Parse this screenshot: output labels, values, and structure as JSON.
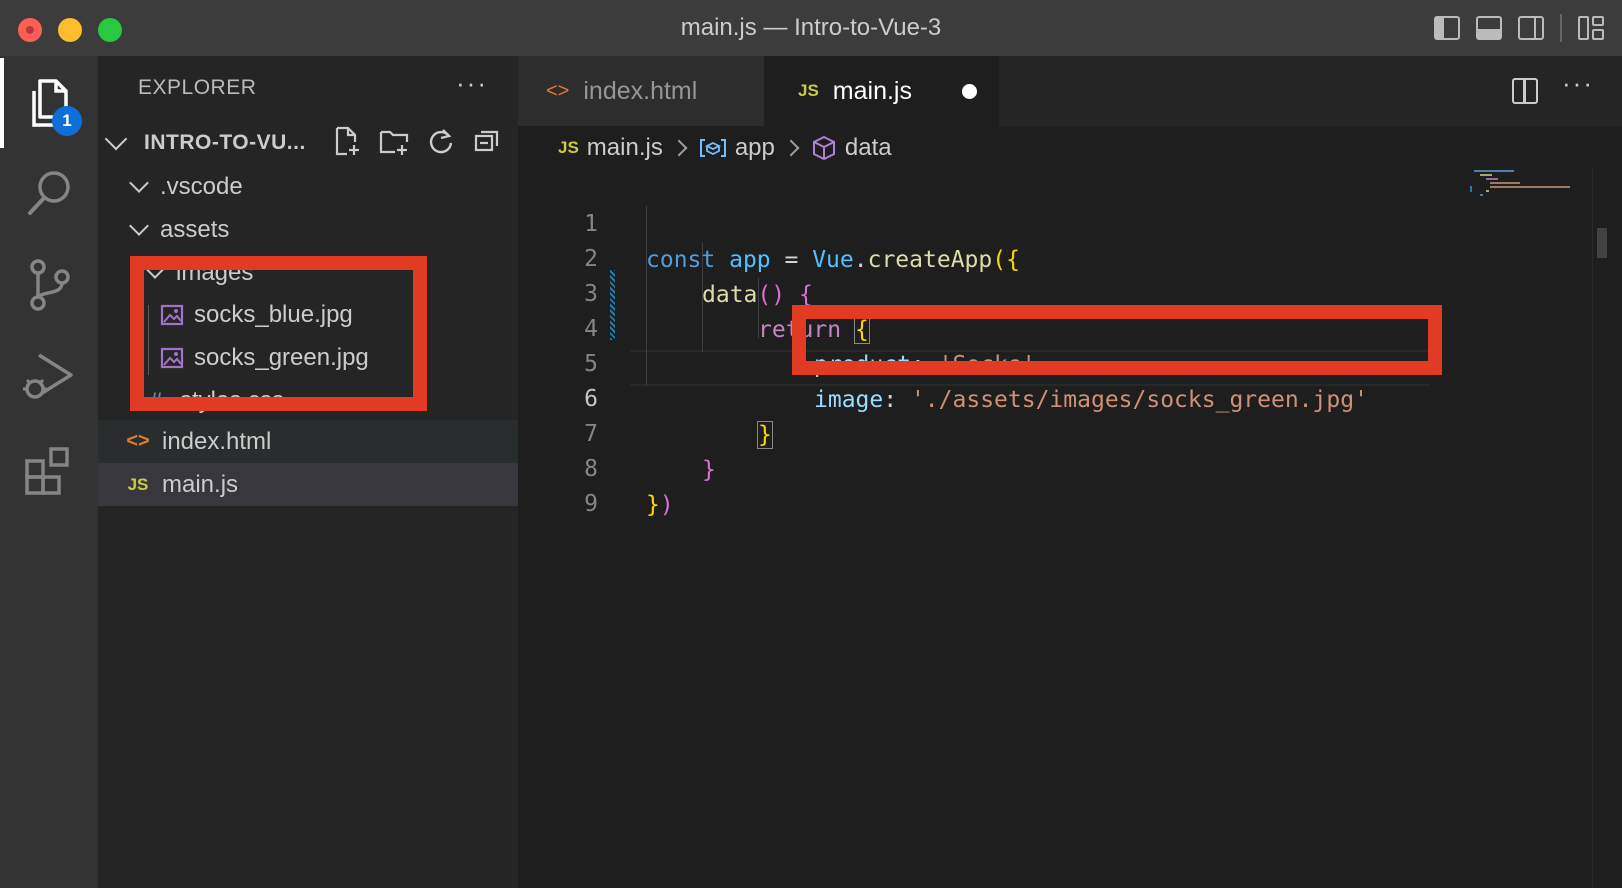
{
  "window": {
    "title": "main.js — Intro-to-Vue-3"
  },
  "activity_bar": {
    "items": [
      {
        "name": "explorer",
        "badge": "1"
      },
      {
        "name": "search"
      },
      {
        "name": "source-control"
      },
      {
        "name": "run-and-debug"
      },
      {
        "name": "extensions"
      }
    ]
  },
  "sidebar": {
    "header": "EXPLORER",
    "more": "···",
    "folder": "INTRO-TO-VU...",
    "tree": [
      {
        "label": ".vscode",
        "type": "folder"
      },
      {
        "label": "assets",
        "type": "folder"
      },
      {
        "label": "images",
        "type": "folder"
      },
      {
        "label": "socks_blue.jpg",
        "type": "image"
      },
      {
        "label": "socks_green.jpg",
        "type": "image"
      },
      {
        "label": "styles.css",
        "type": "css",
        "icon": "#"
      },
      {
        "label": "index.html",
        "type": "html",
        "icon": "<>"
      },
      {
        "label": "main.js",
        "type": "js",
        "icon": "JS"
      }
    ]
  },
  "tabs": [
    {
      "label": "index.html",
      "icon": "<>",
      "active": false
    },
    {
      "label": "main.js",
      "icon": "JS",
      "active": true,
      "dirty": true
    }
  ],
  "tabs_more": "···",
  "breadcrumb": {
    "file": "main.js",
    "file_icon": "JS",
    "app": "app",
    "data": "data"
  },
  "editor": {
    "current_line": "6",
    "lines": [
      {
        "n": "1"
      },
      {
        "n": "2"
      },
      {
        "n": "3"
      },
      {
        "n": "4"
      },
      {
        "n": "5"
      },
      {
        "n": "6"
      },
      {
        "n": "7"
      },
      {
        "n": "8"
      },
      {
        "n": "9"
      }
    ],
    "tokens": {
      "const": "const",
      "app": "app",
      "eq": " = ",
      "vue": "Vue",
      "dot": ".",
      "createApp": "createApp",
      "open_paren_brace": "({",
      "data": "data",
      "parens": "()",
      "brace_open": "{",
      "return": "return",
      "product_key": "product",
      "colon": ": ",
      "product_val": "'Socks'",
      "comma": ",",
      "image_key": "image",
      "image_val": "'./assets/images/socks_green.jpg'",
      "brace_close": "}",
      "close_brace_paren": "})",
      "close_brace": "}",
      "close_paren": ")"
    }
  },
  "colors": {
    "highlight": "#e23b23",
    "badge": "#0e6fd8"
  }
}
